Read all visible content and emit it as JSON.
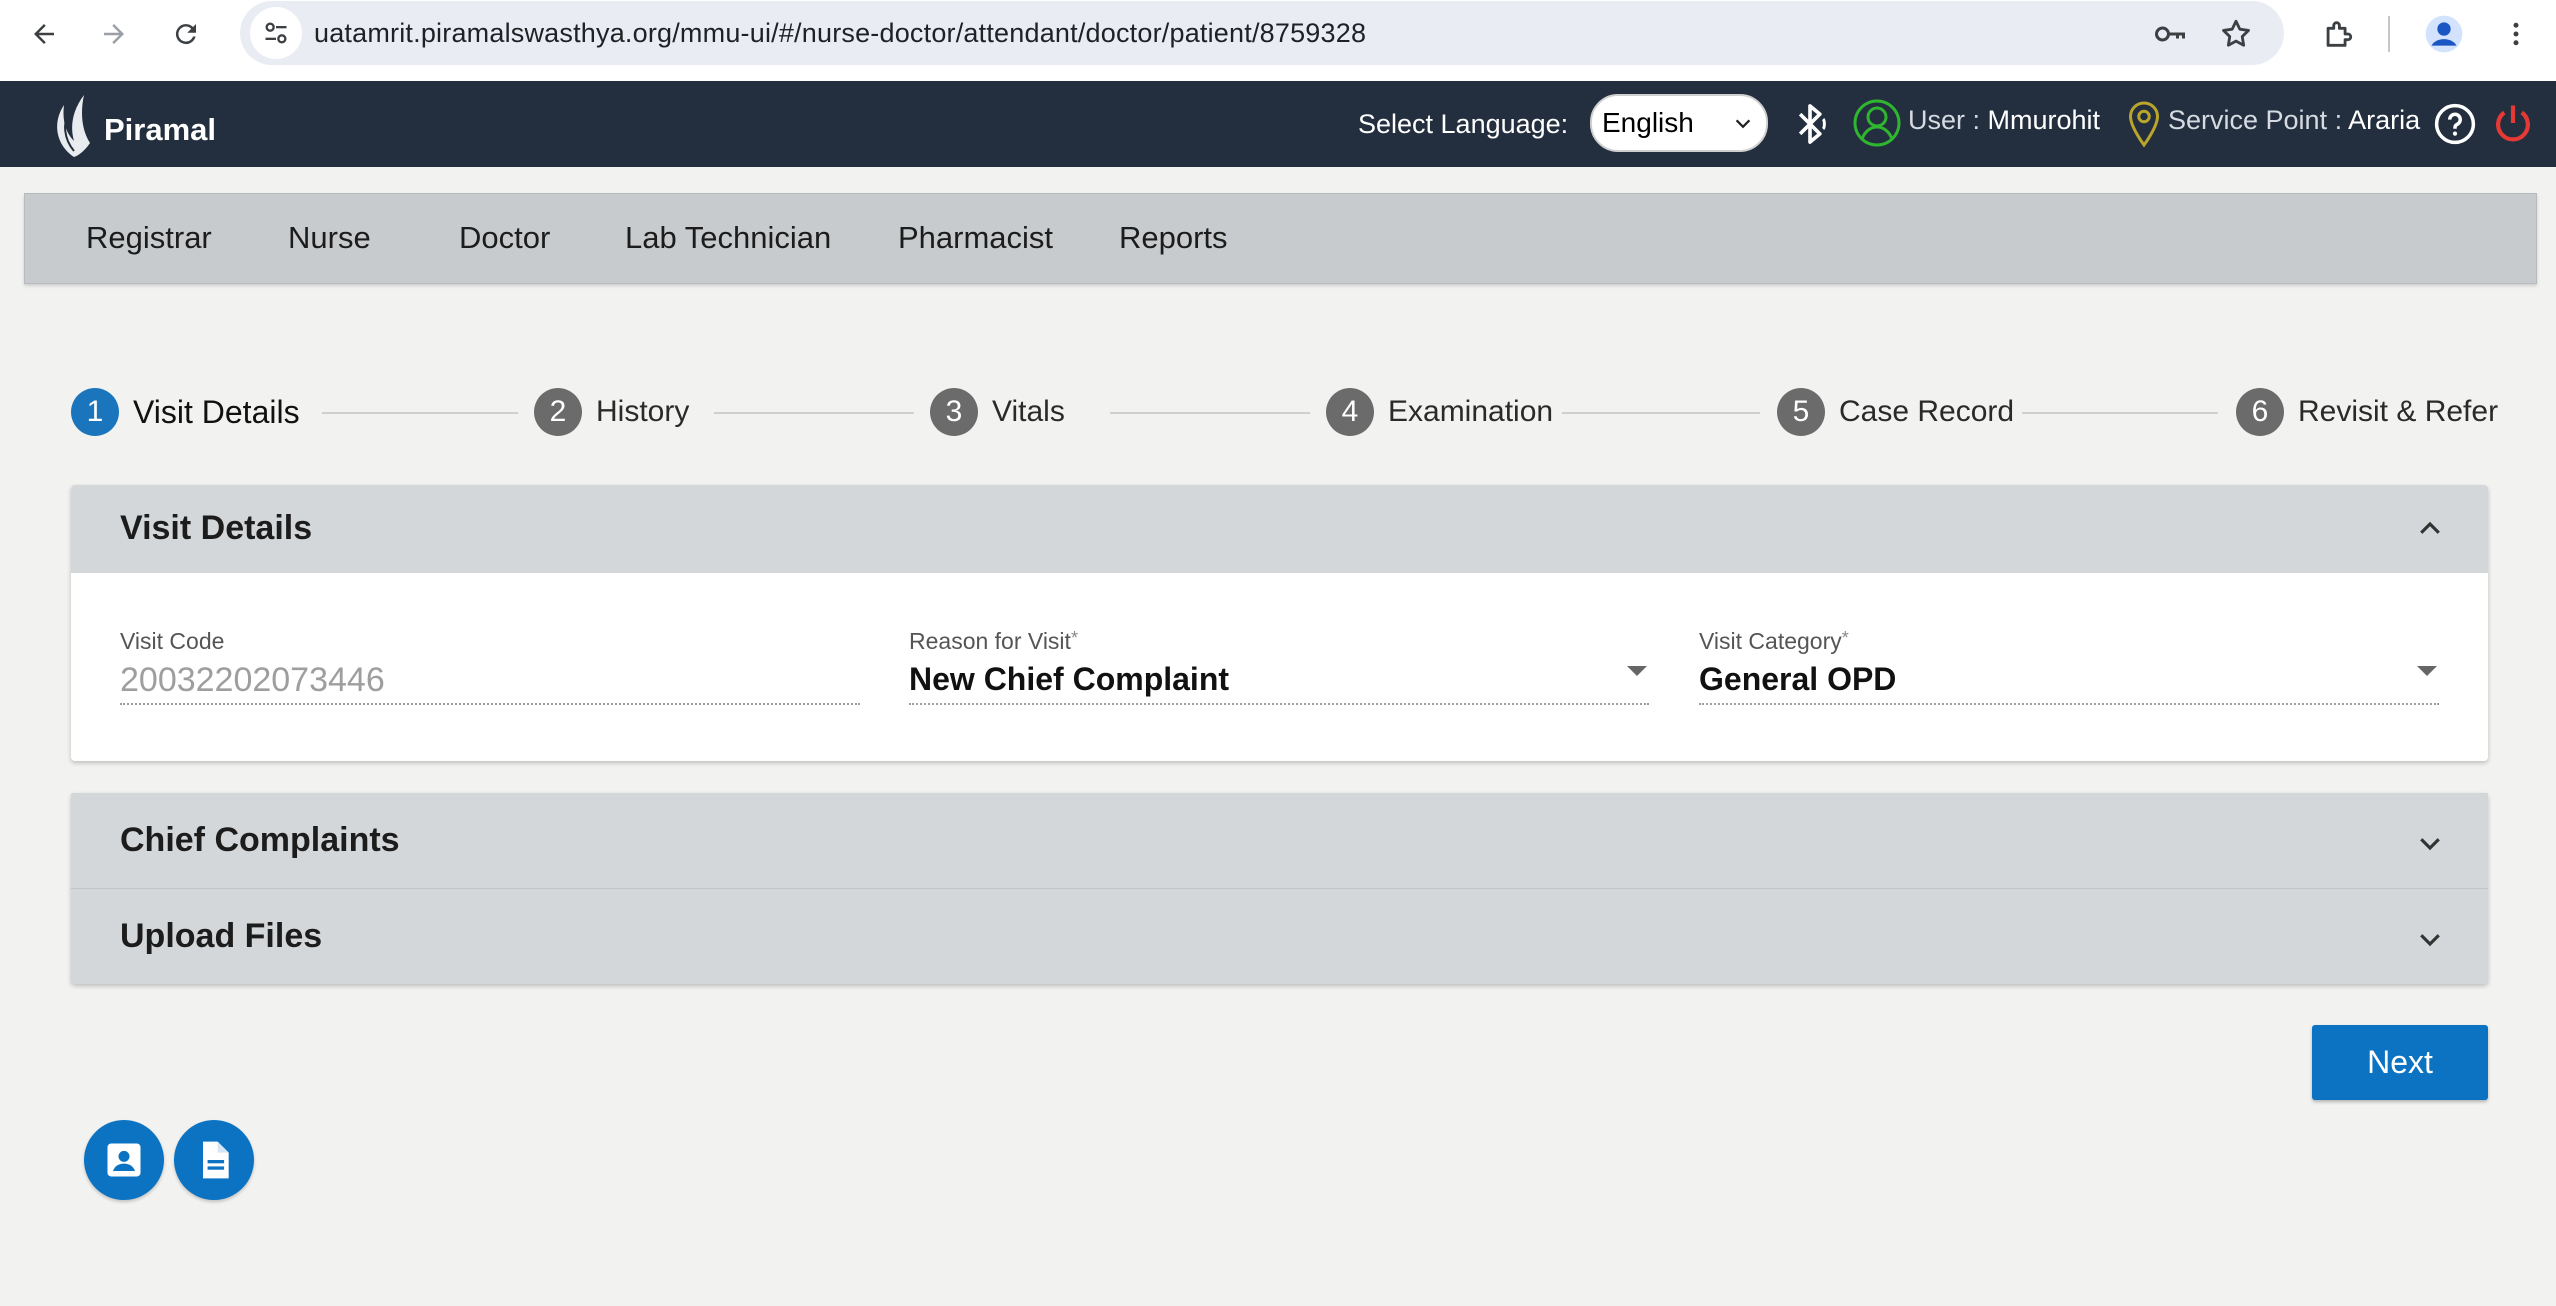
{
  "browser": {
    "url": "uatamrit.piramalswasthya.org/mmu-ui/#/nurse-doctor/attendant/doctor/patient/8759328"
  },
  "header": {
    "logo_text": "Piramal",
    "language_label": "Select Language:",
    "language_selected": "English",
    "user_label": "User :",
    "user_name": "Mmurohit",
    "service_point_label": "Service Point :",
    "service_point_name": "Araria"
  },
  "role_menu": [
    "Registrar",
    "Nurse",
    "Doctor",
    "Lab Technician",
    "Pharmacist",
    "Reports"
  ],
  "stepper": [
    {
      "num": "1",
      "label": "Visit Details",
      "active": true
    },
    {
      "num": "2",
      "label": "History",
      "active": false
    },
    {
      "num": "3",
      "label": "Vitals",
      "active": false
    },
    {
      "num": "4",
      "label": "Examination",
      "active": false
    },
    {
      "num": "5",
      "label": "Case Record",
      "active": false
    },
    {
      "num": "6",
      "label": "Revisit & Refer",
      "active": false
    }
  ],
  "visit_details": {
    "title": "Visit Details",
    "visit_code_label": "Visit Code",
    "visit_code_value": "20032202073446",
    "reason_label": "Reason for Visit",
    "reason_value": "New Chief Complaint",
    "category_label": "Visit Category",
    "category_value": "General OPD",
    "required_mark": "*"
  },
  "sections": {
    "chief_complaints": "Chief Complaints",
    "upload_files": "Upload Files"
  },
  "actions": {
    "next": "Next"
  },
  "colors": {
    "header_bg": "#232f3e",
    "primary": "#0b73c2",
    "step_active": "#1a75bc",
    "step_inactive": "#6b6b6b",
    "bluetooth_icon": "#ffffff",
    "user_icon": "#2fb52f",
    "location_icon": "#b9a52a",
    "power_icon": "#e53935"
  }
}
